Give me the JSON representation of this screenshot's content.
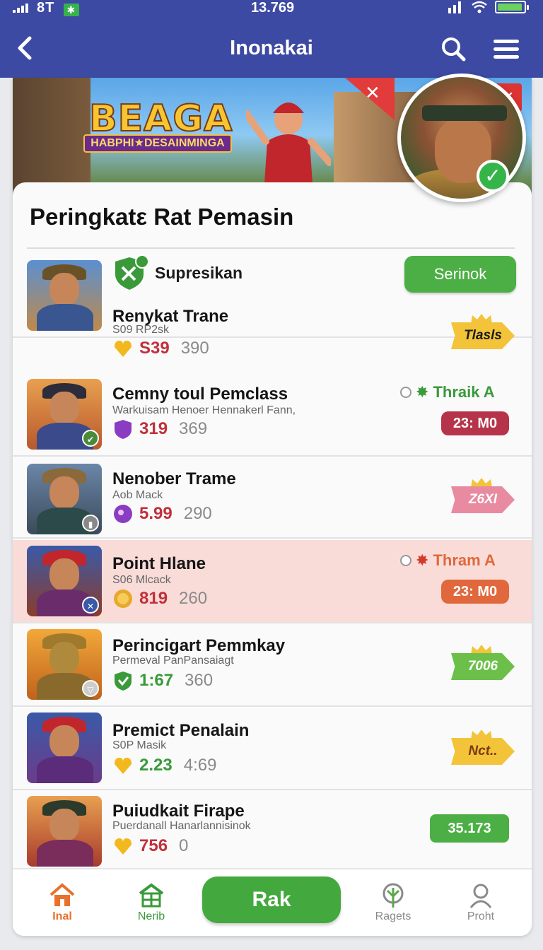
{
  "status_bar": {
    "signal_text": "8T",
    "time": "13.769",
    "battery_level": 0.95
  },
  "app_bar": {
    "title": "Inonakai"
  },
  "banner": {
    "logo_main": "BEAGA",
    "logo_sub": "HABPHI★DESAINMINGA"
  },
  "panel": {
    "title": "Peringkatε Rat Pemasin"
  },
  "rows": [
    {
      "label": "Supresikan",
      "action": "Serinok",
      "name": "Renykat Trane",
      "sub": "S09 RP2sk",
      "v1": "S39",
      "v2": "390",
      "ribbon": "Tlasls",
      "v1_color": "#c2303a",
      "ribbon_color": "#f3c43a"
    },
    {
      "name": "Cemny toul Pemclass",
      "sub": "Warkuisam Henoer Hennakerl Fann,",
      "v1": "319",
      "v2": "369",
      "status": "Thraik A",
      "pill": "23: M0",
      "v1_color": "#c2303a",
      "pill_color": "#b6344a"
    },
    {
      "name": "Nenober Trame",
      "sub": "Aob Mack",
      "v1": "5.99",
      "v2": "290",
      "ribbon": "Z6XI",
      "v1_color": "#c2303a",
      "ribbon_color": "#e88aa0"
    },
    {
      "name": "Point Hlane",
      "sub": "S06 Mlcack",
      "v1": "819",
      "v2": "260",
      "status": "Thram A",
      "pill": "23: M0",
      "v1_color": "#c2303a",
      "pill_color": "#e0683c"
    },
    {
      "name": "Perincigart Pemmkay",
      "sub": "Permeval PanPansaiagt",
      "v1": "1:67",
      "v2": "360",
      "ribbon": "7006",
      "v1_color": "#3a9a3a",
      "ribbon_color": "#6cc04a"
    },
    {
      "name": "Premict Penalain",
      "sub": "S0P Masik",
      "v1": "2.23",
      "v2": "4:69",
      "ribbon": "Nct..",
      "v1_color": "#3a9a3a",
      "ribbon_color": "#f3c43a"
    },
    {
      "name": "Puiudkait Firape",
      "sub": "Puerdanall Hanarlannisinok",
      "v1": "756",
      "v2": "0",
      "pill": "35.173",
      "v1_color": "#c2303a",
      "pill_color": "#4caf45"
    }
  ],
  "bottom_nav": {
    "home": "Inal",
    "news": "Nerib",
    "center": "Rak",
    "rages": "Ragets",
    "profile": "Proht"
  },
  "colors": {
    "primary": "#3d4aa3",
    "accent_green": "#43a83e",
    "highlight_row": "#f9dcd8"
  }
}
